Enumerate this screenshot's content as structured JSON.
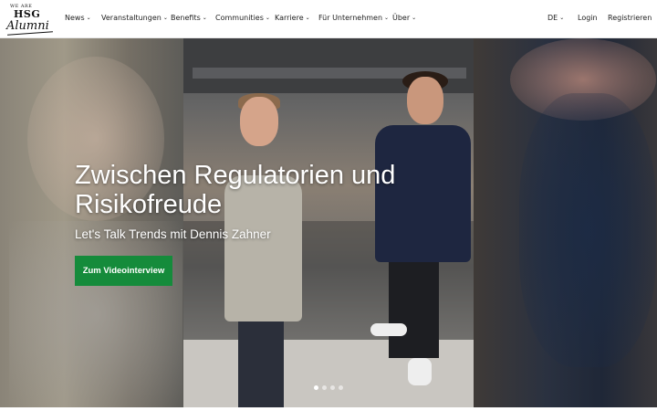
{
  "logo": {
    "line1": "WE ARE",
    "line2": "HSG",
    "line3": "Alumni"
  },
  "nav": {
    "items": [
      {
        "label": "News"
      },
      {
        "label": "Veranstaltungen"
      },
      {
        "label": "Benefits"
      },
      {
        "label": "Communities"
      },
      {
        "label": "Karriere"
      },
      {
        "label": "Für Unternehmen"
      },
      {
        "label": "Über"
      }
    ],
    "language": "DE",
    "login": "Login",
    "register": "Registrieren"
  },
  "hero": {
    "title_line1": "Zwischen Regulatorien und",
    "title_line2": "Risikofreude",
    "subtitle": "Let's Talk Trends mit Dennis Zahner",
    "cta_label": "Zum Videointerview",
    "cta_color": "#158b3b",
    "slides_count": 4,
    "active_slide": 1
  }
}
